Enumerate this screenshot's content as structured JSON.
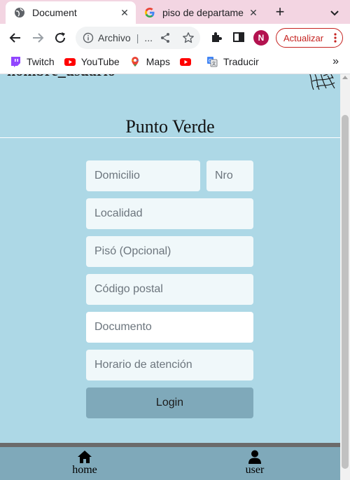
{
  "browser": {
    "tabs": [
      {
        "title": "Document",
        "active": true
      },
      {
        "title": "piso de departame",
        "active": false
      }
    ],
    "omnibox": {
      "origin": "Archivo",
      "sep": "|",
      "truncated": "..."
    },
    "profile_initial": "N",
    "update_label": "Actualizar",
    "bookmarks": [
      {
        "label": "Twitch",
        "icon": "twitch-icon"
      },
      {
        "label": "YouTube",
        "icon": "youtube-icon"
      },
      {
        "label": "Maps",
        "icon": "maps-icon"
      },
      {
        "label": "",
        "icon": "youtube-icon"
      },
      {
        "label": "Traducir",
        "icon": "translate-icon"
      }
    ],
    "bookmarks_more": "»"
  },
  "page": {
    "username": "nombre_usuario",
    "brand": "Punto Verde",
    "form": {
      "domicilio_placeholder": "Domicilio",
      "nro_placeholder": "Nro",
      "localidad_placeholder": "Localidad",
      "piso_placeholder": "Pisó (Opcional)",
      "codigo_placeholder": "Código postal",
      "documento_placeholder": "Documento",
      "horario_placeholder": "Horario de atención",
      "login_label": "Login"
    },
    "nav": {
      "home_label": "home",
      "user_label": "user"
    }
  },
  "colors": {
    "page_bg": "#add8e6",
    "button_bg": "#7fa9ba",
    "update_accent": "#c5221f",
    "tabstrip_bg": "#f3d5e2"
  }
}
